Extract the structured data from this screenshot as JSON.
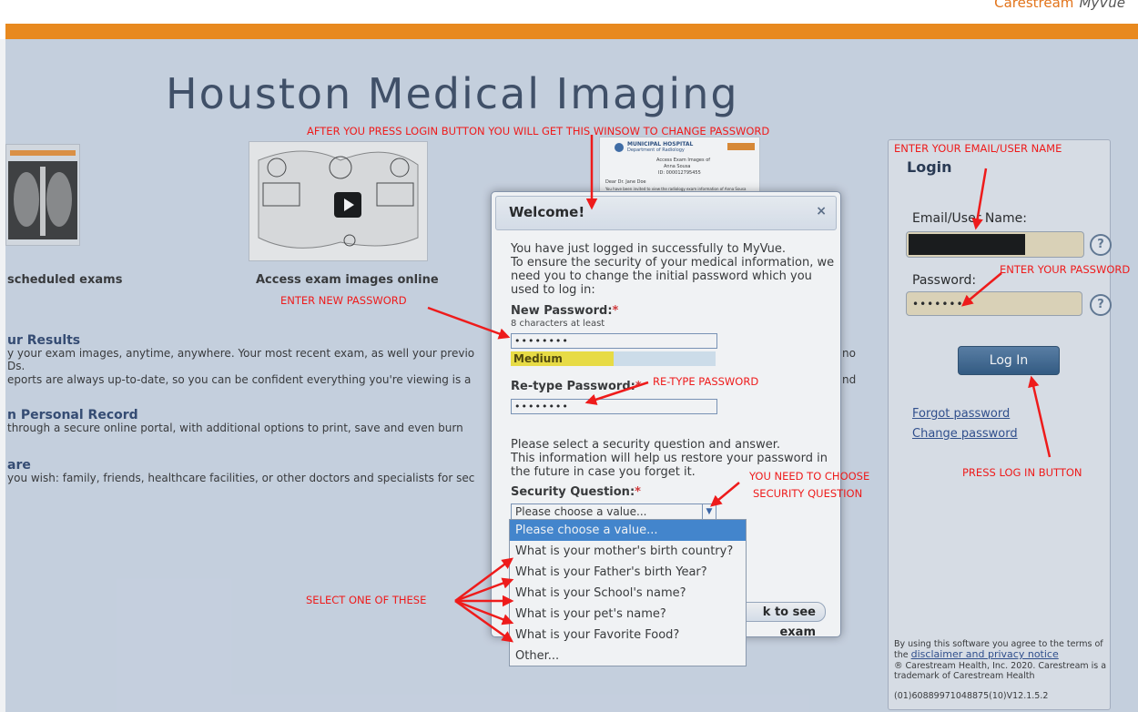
{
  "brand": {
    "left": "Carestream",
    "right": "MyVue"
  },
  "site": {
    "title": "Houston Medical Imaging"
  },
  "features": {
    "captions": [
      "scheduled exams",
      "Access exam images online"
    ],
    "sections": [
      {
        "heading": "ur Results",
        "lines": [
          "y your exam images, anytime, anywhere. Your most recent exam, as well your previo",
          "Ds.",
          "eports are always up-to-date, so you can be confident everything you're viewing is a"
        ]
      },
      {
        "heading": "n Personal Record",
        "lines": [
          " through a secure online portal, with additional options to print, save and even burn"
        ]
      },
      {
        "heading": "are",
        "lines": [
          " you wish: family, friends, healthcare facilities, or other doctors and specialists for sec"
        ]
      }
    ],
    "fragments": {
      "no": "no",
      "nd": "nd"
    }
  },
  "letter": {
    "hospital": "MUNICIPAL HOSPITAL",
    "dept": "Department of Radiology",
    "line1": "Access Exam Images of",
    "line2": "Anna Sousa",
    "line3": "ID: 000012795455",
    "line4": "Dear Dr. Jane Doe",
    "line5": "You have been invited to view the radiology exam information of Anna Sousa"
  },
  "login": {
    "title": "Login",
    "email_label": "Email/User Name:",
    "password_label": "Password:",
    "password_value": "••••••••",
    "login_button": "Log In",
    "forgot": "Forgot password",
    "change": "Change password",
    "help": "?",
    "legal_1": "By using this software you agree to the terms of",
    "legal_2": "the",
    "legal_link": "disclaimer and privacy notice",
    "legal_3": "® Carestream Health, Inc. 2020. Carestream is a",
    "legal_4": "trademark of Carestream Health",
    "version": "(01)60889971048875(10)V12.1.5.2"
  },
  "modal": {
    "title": "Welcome!",
    "close": "×",
    "intro": [
      "You have just logged in successfully to MyVue.",
      "To ensure the security of your medical information, we",
      "need you to change the initial password which you",
      "used to log in:"
    ],
    "new_pw_label": "New Password:",
    "new_pw_hint": "8 characters at least",
    "required": "*",
    "new_pw_value": "••••••••",
    "strength": "Medium",
    "strength_fraction": 0.5,
    "retype_label": "Re-type Password:",
    "retype_value": "••••••••",
    "sq_intro": [
      "Please select a security question and answer.",
      "This information will help us restore your password in",
      "the future in case you forget it."
    ],
    "sq_label": "Security Question:",
    "sq_value": "Please choose a value...",
    "sq_options": [
      "Please choose a value...",
      "What is your mother's birth country?",
      "What is your Father's birth Year?",
      "What is your School's name?",
      "What is your pet's name?",
      "What is your Favorite Food?",
      "Other..."
    ],
    "see_exam": "k to see exam"
  },
  "annotations": {
    "top": "AFTER YOU PRESS LOGIN BUTTON YOU WILL GET THIS WINSOW TO CHANGE PASSWORD",
    "new_pw": "ENTER NEW PASSWORD",
    "retype": "RE-TYPE PASSWORD",
    "choose_1": "YOU NEED TO CHOOSE",
    "choose_2": "SECURITY QUESTION",
    "select": "SELECT ONE OF THESE",
    "email": "ENTER YOUR EMAIL/USER NAME",
    "password": "ENTER YOUR PASSWORD",
    "press": "PRESS LOG IN  BUTTON"
  },
  "colors": {
    "accent_bar": "#e8891f",
    "annotation": "#ee1b1b",
    "primary_button": "#3a6590"
  }
}
